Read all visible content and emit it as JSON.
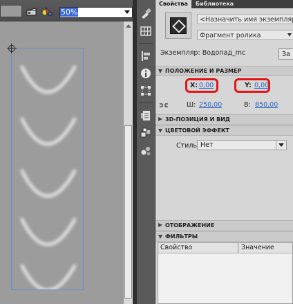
{
  "toolbar": {
    "zoom_value": "50%",
    "icons": [
      "edit-scene-icon",
      "edit-symbol-icon"
    ]
  },
  "tools": {
    "icons": [
      "brush-icon",
      "grid-icon",
      "align-icon",
      "info-icon",
      "transform-icon",
      "history-icon",
      "components-icon",
      "swatches-icon"
    ]
  },
  "panel": {
    "tabs": [
      {
        "label": "Свойства",
        "active": true
      },
      {
        "label": "Библиотека",
        "active": false
      }
    ],
    "instance_name_placeholder": "<Назначить имя экземпляру>",
    "symbol_type": "Фрагмент ролика",
    "instance_label": "Экземпляр:",
    "instance_value": "Водопад_mc",
    "swap_label": "За",
    "sections": {
      "position_size": "ПОЛОЖЕНИЕ И РАЗМЕР",
      "position_3d": "3D-ПОЗИЦИЯ И ВИД",
      "color_effect": "ЦВЕТОВОЙ ЭФФЕКТ",
      "display": "ОТОБРАЖЕНИЕ",
      "filters": "ФИЛЬТРЫ"
    },
    "position": {
      "x_label": "X:",
      "x_value": "0,00",
      "y_label": "Y:",
      "y_value": "0,00",
      "w_label": "Ш:",
      "w_value": "250,00",
      "h_label": "В:",
      "h_value": "850,00"
    },
    "color_effect": {
      "style_label": "Стиль:",
      "style_value": "Нет"
    },
    "filters": {
      "columns": [
        "Свойство",
        "Значение"
      ]
    }
  },
  "colors": {
    "highlight": "#e01616",
    "link_value": "#2a64c8",
    "selection_box": "#5d8fd6"
  }
}
